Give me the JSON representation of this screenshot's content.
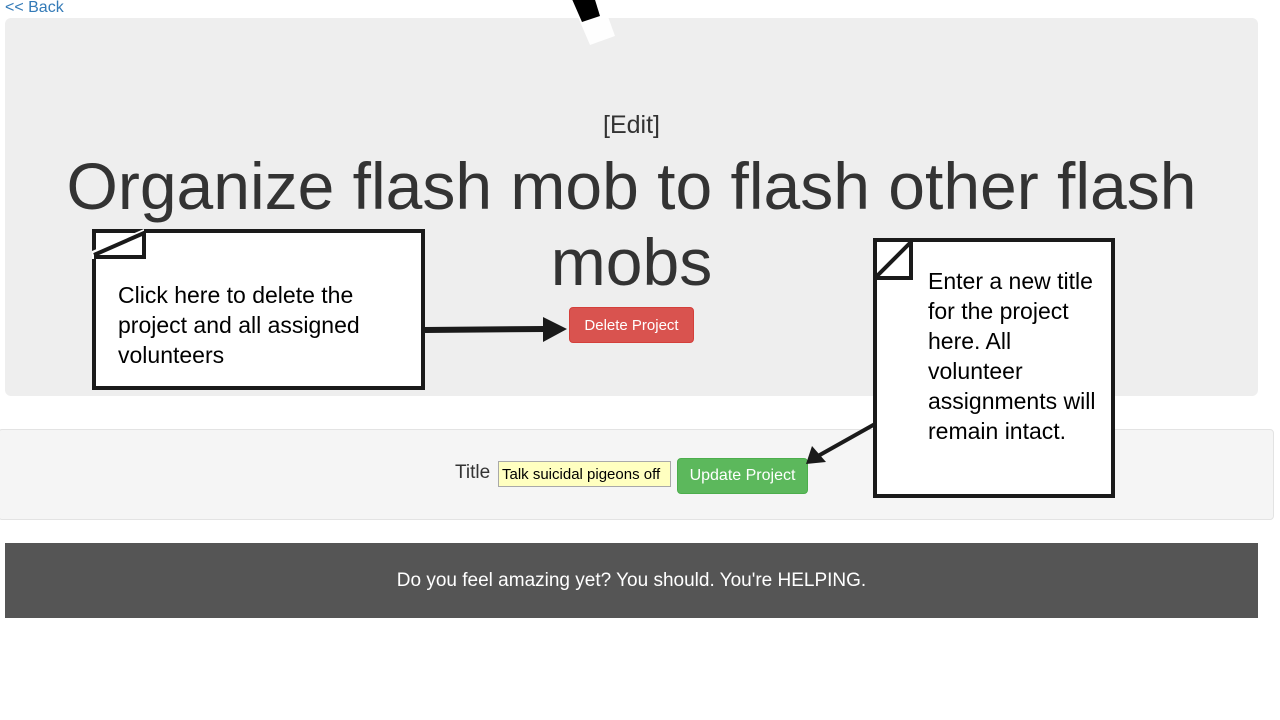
{
  "nav": {
    "back_label": "<< Back"
  },
  "header": {
    "edit_label": "[Edit]",
    "project_title": "Organize flash mob to flash other flash mobs",
    "delete_label": "Delete Project"
  },
  "form": {
    "title_label": "Title",
    "title_value": "Talk suicidal pigeons off",
    "update_label": "Update Project"
  },
  "footer": {
    "text": "Do you feel amazing yet? You should. You're HELPING."
  },
  "callouts": {
    "delete_text": "Click here to delete the project and all assigned volunteers",
    "update_text": "Enter a new title for the project here. All volunteer assignments will remain intact."
  },
  "icons": {
    "cursor": "mouse-pointer-icon",
    "arrow": "arrow-icon"
  },
  "colors": {
    "link": "#337ab7",
    "danger": "#d9534f",
    "success": "#5cb85c",
    "footer_bg": "#555555",
    "jumbotron_bg": "#eeeeee",
    "input_highlight": "#ffffc0"
  }
}
